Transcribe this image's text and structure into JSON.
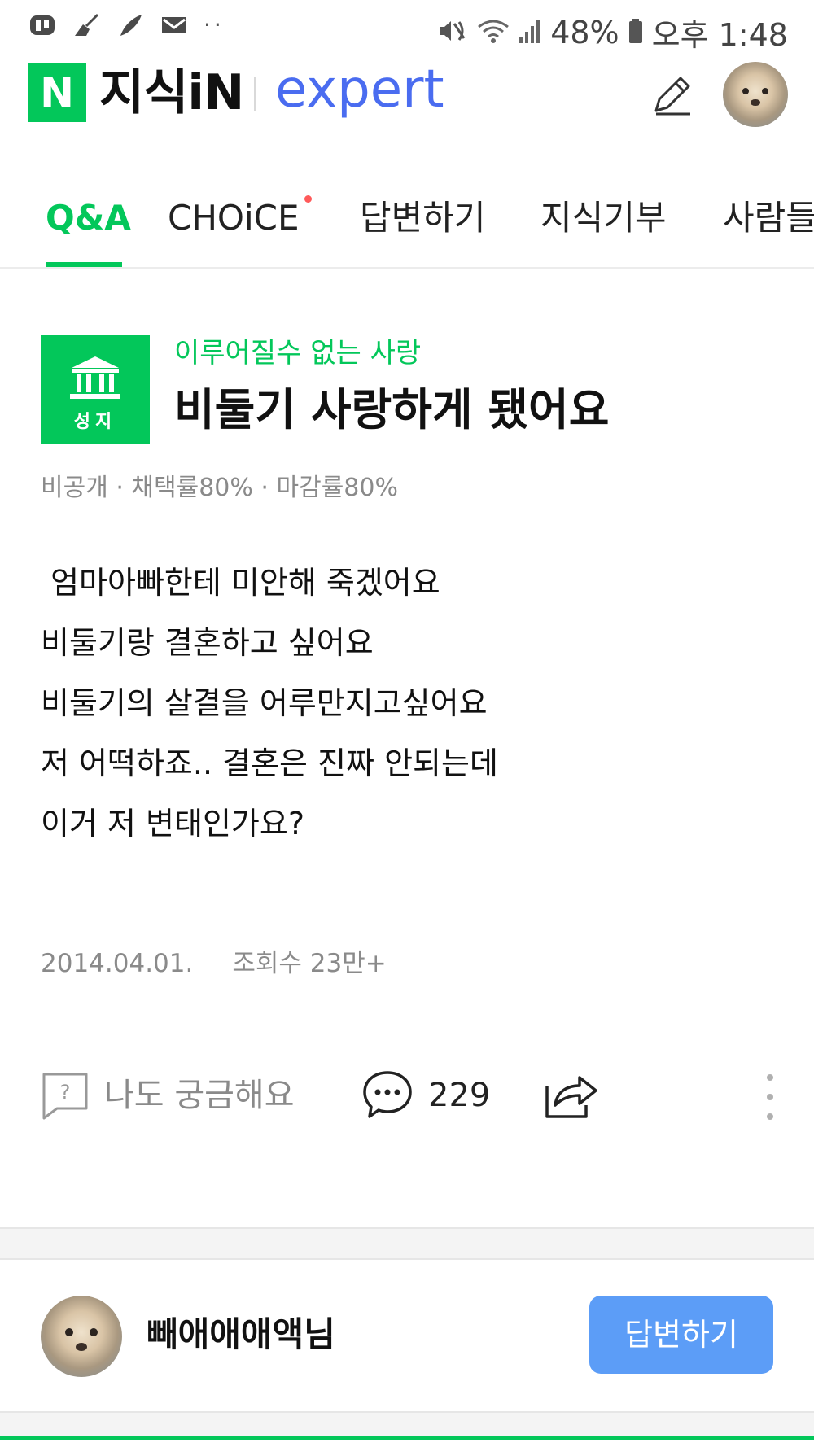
{
  "status_bar": {
    "battery": "48%",
    "time": "오후 1:48",
    "left_icons": [
      "app-icon",
      "broom-icon",
      "feather-icon",
      "mail-icon"
    ],
    "more": "··"
  },
  "header": {
    "logo_letter": "N",
    "logo_text": "지식iN",
    "expert_label": "expert",
    "brand_color": "#03c75a",
    "expert_color": "#4a6cf0"
  },
  "tabs": [
    {
      "label": "Q&A",
      "active": true
    },
    {
      "label": "CHOiCE",
      "active": false,
      "has_dot": true
    },
    {
      "label": "답변하기",
      "active": false
    },
    {
      "label": "지식기부",
      "active": false
    },
    {
      "label": "사람들",
      "active": false
    }
  ],
  "question": {
    "badge_label": "성지",
    "category": "이루어질수 없는 사랑",
    "title": "비둘기 사랑하게 됐어요",
    "meta": "비공개 · 채택률80% · 마감률80%",
    "body_lines": [
      " 엄마아빠한테 미안해 죽겠어요",
      "비둘기랑 결혼하고 싶어요",
      "비둘기의 살결을 어루만지고싶어요",
      "저 어떡하죠.. 결혼은 진짜 안되는데",
      "이거 저 변태인가요?"
    ],
    "date": "2014.04.01.",
    "views": "조회수 23만+"
  },
  "actions": {
    "curious_label": "나도 궁금해요",
    "comment_count": "229"
  },
  "answer_section": {
    "asker_name": "빼애애애액님",
    "answer_button": "답변하기",
    "button_color": "#5c9df7"
  }
}
